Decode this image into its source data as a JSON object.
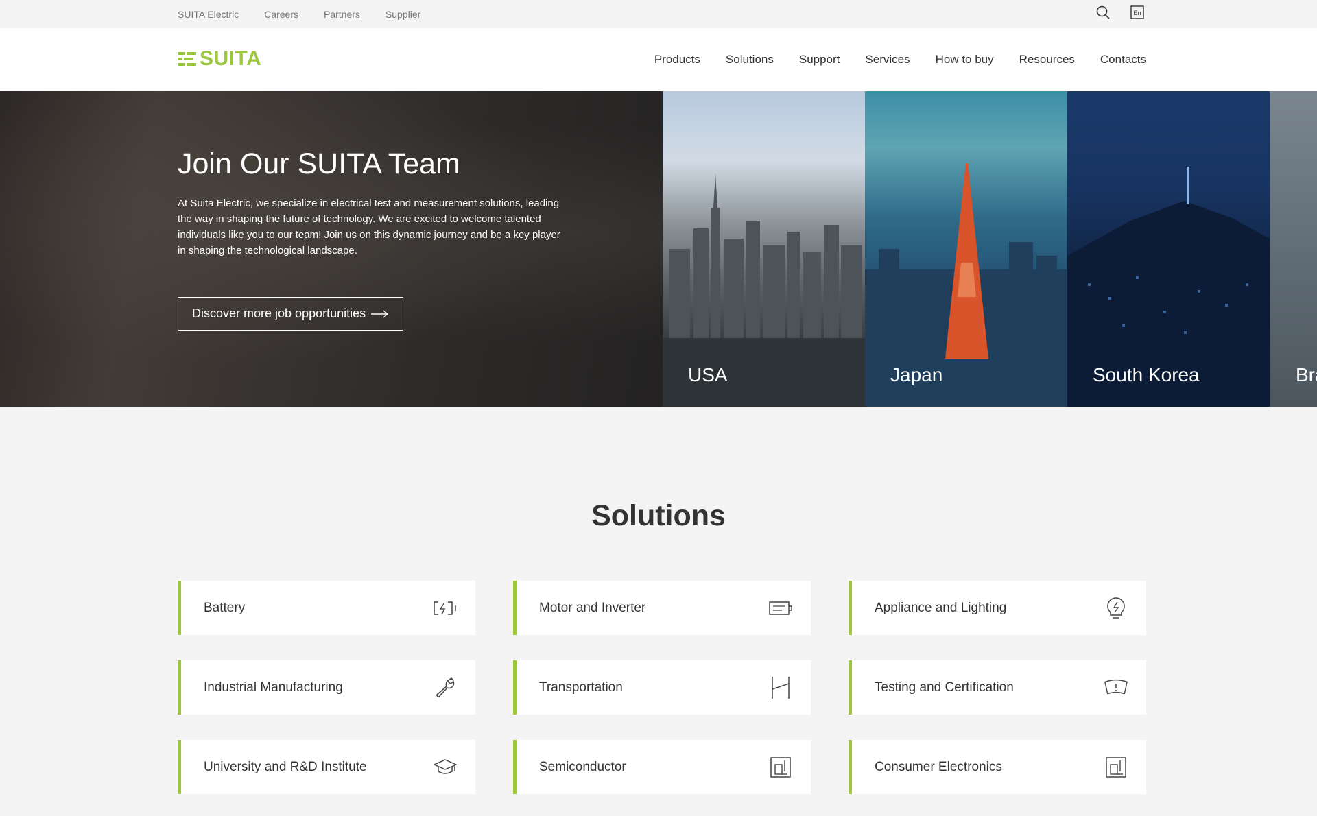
{
  "topbar": {
    "links": [
      "SUITA Electric",
      "Careers",
      "Partners",
      "Supplier"
    ],
    "language_label": "En"
  },
  "header": {
    "logo_text": "SUITA",
    "nav": [
      "Products",
      "Solutions",
      "Support",
      "Services",
      "How to buy",
      "Resources",
      "Contacts"
    ]
  },
  "hero": {
    "title": "Join Our SUITA Team",
    "text": "At Suita Electric, we specialize in electrical test and measurement solutions, leading the way in shaping the future of technology. We are excited to welcome talented individuals like you to our team! Join us on this dynamic journey and be a key player in shaping the technological landscape.",
    "button_label": "Discover more job opportunities",
    "cities": [
      "USA",
      "Japan",
      "South Korea",
      "Bra"
    ]
  },
  "solutions": {
    "title": "Solutions",
    "items": [
      {
        "label": "Battery",
        "icon": "battery-icon"
      },
      {
        "label": "Motor and Inverter",
        "icon": "motor-icon"
      },
      {
        "label": "Appliance and Lighting",
        "icon": "bulb-icon"
      },
      {
        "label": "Industrial Manufacturing",
        "icon": "wrench-icon"
      },
      {
        "label": "Transportation",
        "icon": "road-icon"
      },
      {
        "label": "Testing and Certification",
        "icon": "certification-icon"
      },
      {
        "label": "University and R&D Institute",
        "icon": "graduation-cap-icon"
      },
      {
        "label": "Semiconductor",
        "icon": "chip-icon"
      },
      {
        "label": "Consumer Electronics",
        "icon": "device-icon"
      }
    ]
  },
  "colors": {
    "accent": "#9cc63b",
    "text": "#333333",
    "background": "#f4f4f4"
  }
}
